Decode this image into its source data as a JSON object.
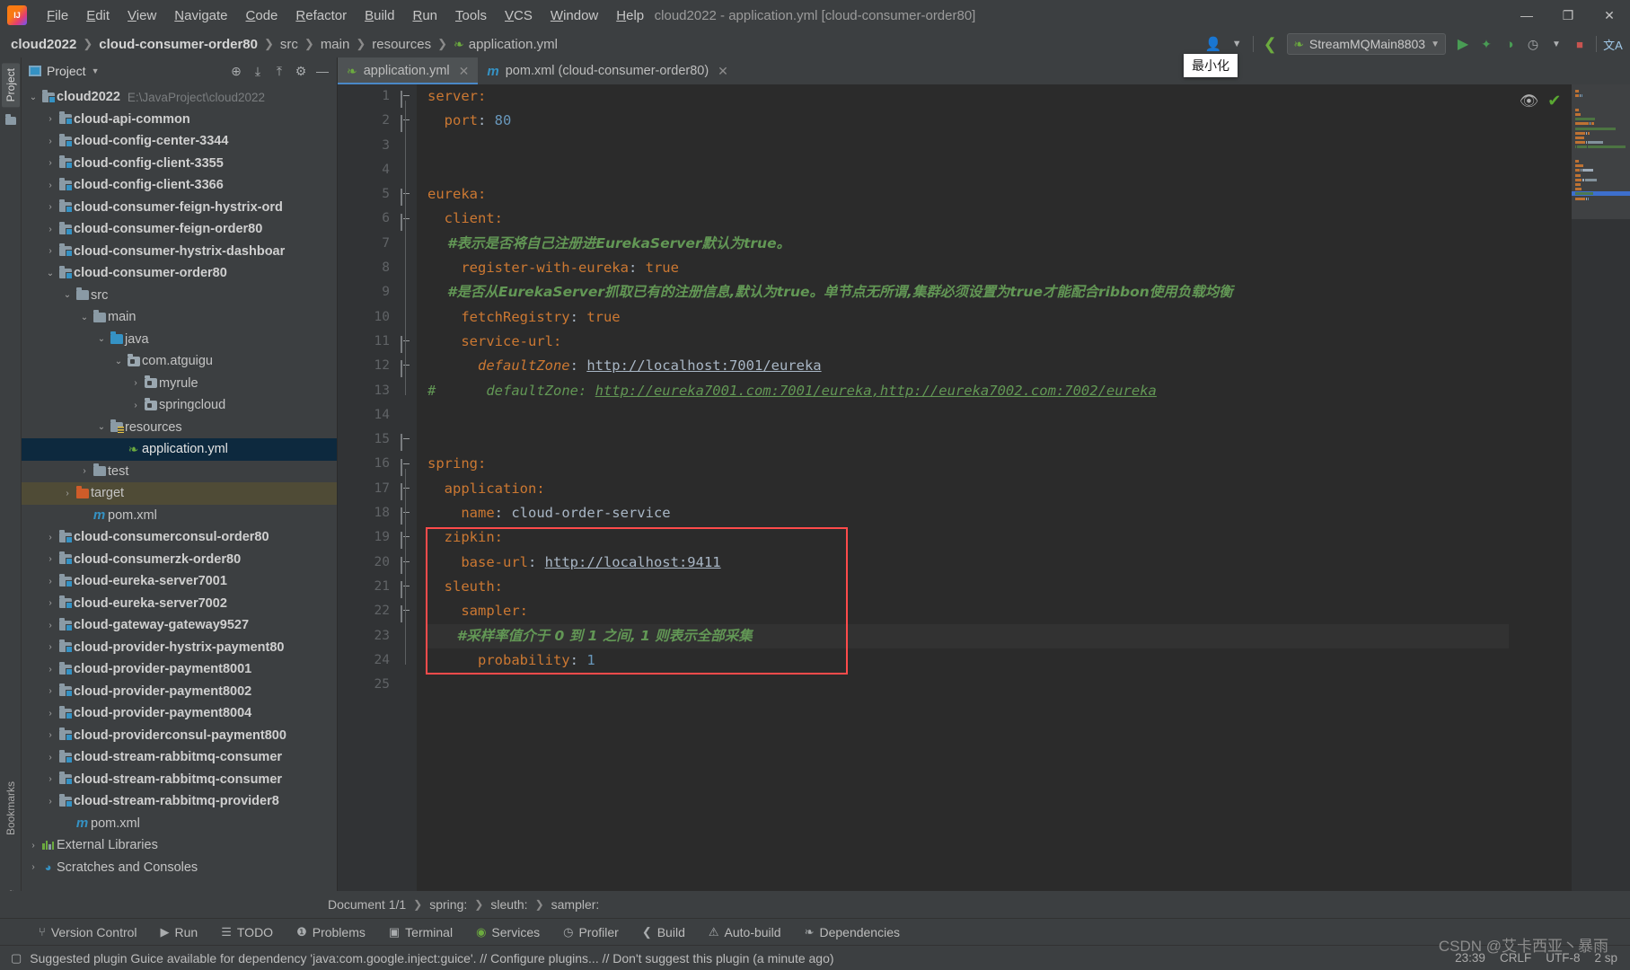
{
  "window": {
    "title": "cloud2022 - application.yml [cloud-consumer-order80]",
    "logo_text": "IJ",
    "minimize": "—",
    "maximize": "❐",
    "close": "✕"
  },
  "menu": [
    "File",
    "Edit",
    "View",
    "Navigate",
    "Code",
    "Refactor",
    "Build",
    "Run",
    "Tools",
    "VCS",
    "Window",
    "Help"
  ],
  "breadcrumb": [
    "cloud2022",
    "cloud-consumer-order80",
    "src",
    "main",
    "resources",
    "application.yml"
  ],
  "toolbar": {
    "run_config": "StreamMQMain8803",
    "run_icon": "▶",
    "debug_icon": "🐞",
    "coverage_icon": "◖",
    "profiler_icon": "◷",
    "stop_icon": "■",
    "user_icon": "👤",
    "build_icon": "🔨",
    "search_icon": "文A"
  },
  "tooltip": {
    "minimize_label": "最小化"
  },
  "left_strip": {
    "project": "Project",
    "bookmarks": "Bookmarks",
    "structure": "Structure"
  },
  "project_panel": {
    "title": "Project",
    "actions": [
      "locate-icon",
      "expand-all-icon",
      "collapse-all-icon",
      "settings-icon",
      "hide-icon"
    ],
    "tree": [
      {
        "indent": 0,
        "arrow": "v",
        "icon": "module",
        "label": "cloud2022",
        "bold": true,
        "hint": "E:\\JavaProject\\cloud2022"
      },
      {
        "indent": 1,
        "arrow": ">",
        "icon": "module",
        "label": "cloud-api-common",
        "bold": true
      },
      {
        "indent": 1,
        "arrow": ">",
        "icon": "module",
        "label": "cloud-config-center-3344",
        "bold": true
      },
      {
        "indent": 1,
        "arrow": ">",
        "icon": "module",
        "label": "cloud-config-client-3355",
        "bold": true
      },
      {
        "indent": 1,
        "arrow": ">",
        "icon": "module",
        "label": "cloud-config-client-3366",
        "bold": true
      },
      {
        "indent": 1,
        "arrow": ">",
        "icon": "module",
        "label": "cloud-consumer-feign-hystrix-ord",
        "bold": true
      },
      {
        "indent": 1,
        "arrow": ">",
        "icon": "module",
        "label": "cloud-consumer-feign-order80",
        "bold": true
      },
      {
        "indent": 1,
        "arrow": ">",
        "icon": "module",
        "label": "cloud-consumer-hystrix-dashboar",
        "bold": true
      },
      {
        "indent": 1,
        "arrow": "v",
        "icon": "module",
        "label": "cloud-consumer-order80",
        "bold": true
      },
      {
        "indent": 2,
        "arrow": "v",
        "icon": "folder",
        "label": "src"
      },
      {
        "indent": 3,
        "arrow": "v",
        "icon": "folder",
        "label": "main"
      },
      {
        "indent": 4,
        "arrow": "v",
        "icon": "source",
        "label": "java"
      },
      {
        "indent": 5,
        "arrow": "v",
        "icon": "package",
        "label": "com.atguigu"
      },
      {
        "indent": 6,
        "arrow": ">",
        "icon": "package",
        "label": "myrule"
      },
      {
        "indent": 6,
        "arrow": ">",
        "icon": "package",
        "label": "springcloud"
      },
      {
        "indent": 4,
        "arrow": "v",
        "icon": "resources",
        "label": "resources"
      },
      {
        "indent": 5,
        "arrow": "",
        "icon": "yml",
        "label": "application.yml",
        "selected": true
      },
      {
        "indent": 3,
        "arrow": ">",
        "icon": "folder",
        "label": "test"
      },
      {
        "indent": 2,
        "arrow": ">",
        "icon": "target",
        "label": "target",
        "highlight": true
      },
      {
        "indent": 3,
        "arrow": "",
        "icon": "maven",
        "label": "pom.xml"
      },
      {
        "indent": 1,
        "arrow": ">",
        "icon": "module",
        "label": "cloud-consumerconsul-order80",
        "bold": true
      },
      {
        "indent": 1,
        "arrow": ">",
        "icon": "module",
        "label": "cloud-consumerzk-order80",
        "bold": true
      },
      {
        "indent": 1,
        "arrow": ">",
        "icon": "module",
        "label": "cloud-eureka-server7001",
        "bold": true
      },
      {
        "indent": 1,
        "arrow": ">",
        "icon": "module",
        "label": "cloud-eureka-server7002",
        "bold": true
      },
      {
        "indent": 1,
        "arrow": ">",
        "icon": "module",
        "label": "cloud-gateway-gateway9527",
        "bold": true
      },
      {
        "indent": 1,
        "arrow": ">",
        "icon": "module",
        "label": "cloud-provider-hystrix-payment80",
        "bold": true
      },
      {
        "indent": 1,
        "arrow": ">",
        "icon": "module",
        "label": "cloud-provider-payment8001",
        "bold": true
      },
      {
        "indent": 1,
        "arrow": ">",
        "icon": "module",
        "label": "cloud-provider-payment8002",
        "bold": true
      },
      {
        "indent": 1,
        "arrow": ">",
        "icon": "module",
        "label": "cloud-provider-payment8004",
        "bold": true
      },
      {
        "indent": 1,
        "arrow": ">",
        "icon": "module",
        "label": "cloud-providerconsul-payment800",
        "bold": true
      },
      {
        "indent": 1,
        "arrow": ">",
        "icon": "module",
        "label": "cloud-stream-rabbitmq-consumer",
        "bold": true
      },
      {
        "indent": 1,
        "arrow": ">",
        "icon": "module",
        "label": "cloud-stream-rabbitmq-consumer",
        "bold": true
      },
      {
        "indent": 1,
        "arrow": ">",
        "icon": "module",
        "label": "cloud-stream-rabbitmq-provider8",
        "bold": true
      },
      {
        "indent": 2,
        "arrow": "",
        "icon": "maven",
        "label": "pom.xml"
      },
      {
        "indent": 0,
        "arrow": ">",
        "icon": "library",
        "label": "External Libraries"
      },
      {
        "indent": 0,
        "arrow": ">",
        "icon": "scratch",
        "label": "Scratches and Consoles"
      }
    ]
  },
  "editor": {
    "tabs": [
      {
        "label": "application.yml",
        "icon": "yml-icon",
        "active": true,
        "close": "✕"
      },
      {
        "label": "pom.xml (cloud-consumer-order80)",
        "icon": "maven-icon",
        "active": false,
        "close": "✕"
      }
    ],
    "inspection": {
      "eye_icon": "👁",
      "ok_icon": "✔"
    },
    "lines": [
      {
        "n": 1,
        "segs": [
          {
            "t": "server:",
            "c": "k"
          }
        ]
      },
      {
        "n": 2,
        "segs": [
          {
            "t": "  port",
            "c": "k"
          },
          {
            "t": ": ",
            "c": "v"
          },
          {
            "t": "80",
            "c": "num"
          }
        ]
      },
      {
        "n": 3,
        "segs": []
      },
      {
        "n": 4,
        "segs": []
      },
      {
        "n": 5,
        "segs": [
          {
            "t": "eureka:",
            "c": "k"
          }
        ]
      },
      {
        "n": 6,
        "segs": [
          {
            "t": "  client:",
            "c": "k"
          }
        ]
      },
      {
        "n": 7,
        "segs": [
          {
            "t": "    #表示是否将自己注册进EurekaServer默认为true。",
            "c": "cm"
          }
        ]
      },
      {
        "n": 8,
        "segs": [
          {
            "t": "    register-with-eureka",
            "c": "k"
          },
          {
            "t": ": ",
            "c": "v"
          },
          {
            "t": "true",
            "c": "k"
          }
        ]
      },
      {
        "n": 9,
        "segs": [
          {
            "t": "    #是否从EurekaServer抓取已有的注册信息,默认为true。单节点无所谓,集群必须设置为true才能配合ribbon使用负载均衡",
            "c": "cm"
          }
        ]
      },
      {
        "n": 10,
        "segs": [
          {
            "t": "    fetchRegistry",
            "c": "k"
          },
          {
            "t": ": ",
            "c": "v"
          },
          {
            "t": "true",
            "c": "k"
          }
        ]
      },
      {
        "n": 11,
        "segs": [
          {
            "t": "    service-url:",
            "c": "k"
          }
        ]
      },
      {
        "n": 12,
        "segs": [
          {
            "t": "      defaultZone",
            "c": "k ital"
          },
          {
            "t": ": ",
            "c": "v"
          },
          {
            "t": "http://localhost:7001/eureka",
            "c": "url"
          }
        ]
      },
      {
        "n": 13,
        "segs": [
          {
            "t": "#",
            "c": "cm2"
          },
          {
            "t": "      defaultZone: ",
            "c": "cm2"
          },
          {
            "t": "http://eureka7001.com:7001/eureka,http://eureka7002.com:7002/eureka",
            "c": "urlg"
          }
        ]
      },
      {
        "n": 14,
        "segs": []
      },
      {
        "n": 15,
        "segs": []
      },
      {
        "n": 16,
        "segs": [
          {
            "t": "spring:",
            "c": "k"
          }
        ]
      },
      {
        "n": 17,
        "segs": [
          {
            "t": "  application:",
            "c": "k"
          }
        ]
      },
      {
        "n": 18,
        "segs": [
          {
            "t": "    name",
            "c": "k"
          },
          {
            "t": ": ",
            "c": "v"
          },
          {
            "t": "cloud-order-service",
            "c": "v"
          }
        ]
      },
      {
        "n": 19,
        "segs": [
          {
            "t": "  zipkin:",
            "c": "k"
          }
        ]
      },
      {
        "n": 20,
        "segs": [
          {
            "t": "    base-url",
            "c": "k"
          },
          {
            "t": ": ",
            "c": "v"
          },
          {
            "t": "http://localhost:9411",
            "c": "url"
          }
        ]
      },
      {
        "n": 21,
        "segs": [
          {
            "t": "  sleuth:",
            "c": "k"
          }
        ]
      },
      {
        "n": 22,
        "segs": [
          {
            "t": "    sampler:",
            "c": "k"
          }
        ]
      },
      {
        "n": 23,
        "segs": [
          {
            "t": "      #采样率值介于 0 到 1 之间, 1 则表示全部采集",
            "c": "cm"
          }
        ],
        "current": true
      },
      {
        "n": 24,
        "segs": [
          {
            "t": "      probability",
            "c": "k"
          },
          {
            "t": ": ",
            "c": "v"
          },
          {
            "t": "1",
            "c": "num"
          }
        ]
      },
      {
        "n": 25,
        "segs": []
      }
    ],
    "highlight_box": {
      "label": "zipkin-sleuth-highlight",
      "color": "#ff4b4b"
    }
  },
  "document_bar": {
    "document": "Document 1/1",
    "crumbs": [
      "spring:",
      "sleuth:",
      "sampler:"
    ]
  },
  "tool_windows": [
    {
      "label": "Version Control",
      "icon": "branch-icon"
    },
    {
      "label": "Run",
      "icon": "play-icon"
    },
    {
      "label": "TODO",
      "icon": "list-icon"
    },
    {
      "label": "Problems",
      "icon": "warning-icon"
    },
    {
      "label": "Terminal",
      "icon": "terminal-icon"
    },
    {
      "label": "Services",
      "icon": "services-icon"
    },
    {
      "label": "Profiler",
      "icon": "profiler-icon"
    },
    {
      "label": "Build",
      "icon": "hammer-icon"
    },
    {
      "label": "Auto-build",
      "icon": "autobuild-icon"
    },
    {
      "label": "Dependencies",
      "icon": "dependencies-icon"
    }
  ],
  "status_bar": {
    "icon": "notification-icon",
    "message": "Suggested plugin Guice available for dependency 'java:com.google.inject:guice'. // Configure plugins... // Don't suggest this plugin (a minute ago)",
    "right": [
      "23:39",
      "CRLF",
      "UTF-8",
      "2 sp"
    ],
    "watermark": "CSDN @艾卡西亚丶暴雨"
  }
}
